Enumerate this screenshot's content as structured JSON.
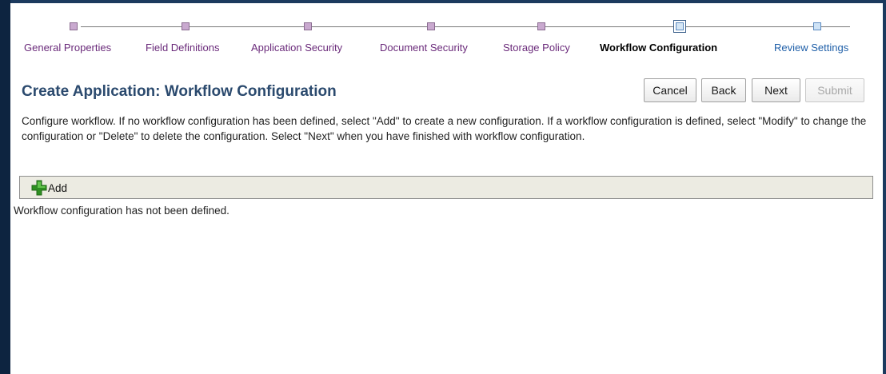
{
  "train": {
    "steps": [
      {
        "label": "General Properties",
        "state": "visited"
      },
      {
        "label": "Field Definitions",
        "state": "visited"
      },
      {
        "label": "Application Security",
        "state": "visited"
      },
      {
        "label": "Document Security",
        "state": "visited"
      },
      {
        "label": "Storage Policy",
        "state": "visited"
      },
      {
        "label": "Workflow Configuration",
        "state": "current"
      },
      {
        "label": "Review Settings",
        "state": "future"
      }
    ]
  },
  "header": {
    "title": "Create Application: Workflow Configuration"
  },
  "buttons": {
    "cancel": "Cancel",
    "back": "Back",
    "next": "Next",
    "submit": "Submit"
  },
  "description": "Configure workflow. If no workflow configuration has been defined, select \"Add\" to create a new configuration. If a workflow configuration is defined, select \"Modify\" to change the configuration or \"Delete\" to delete the configuration. Select \"Next\" when you have finished with workflow configuration.",
  "toolbar": {
    "add_label": "Add",
    "add_icon": "plus-icon"
  },
  "status": {
    "empty_message": "Workflow configuration has not been defined."
  },
  "colors": {
    "visited_step": "#6a2a7a",
    "future_step": "#1f5fa8",
    "title": "#2b4a6e",
    "frame": "#0d2440",
    "toolbar_bg": "#ecebe2",
    "add_icon_green": "#3aa02a"
  }
}
